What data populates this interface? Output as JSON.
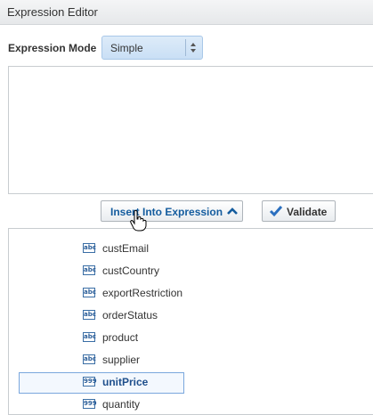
{
  "header": {
    "title": "Expression Editor"
  },
  "mode": {
    "label": "Expression Mode",
    "value": "Simple"
  },
  "expression": {
    "value": ""
  },
  "buttons": {
    "insert_label": "Insert Into Expression",
    "validate_label": "Validate"
  },
  "fields": [
    {
      "name": "custEmail",
      "type_icon": "abc"
    },
    {
      "name": "custCountry",
      "type_icon": "abc"
    },
    {
      "name": "exportRestriction",
      "type_icon": "abc"
    },
    {
      "name": "orderStatus",
      "type_icon": "abc"
    },
    {
      "name": "product",
      "type_icon": "abc"
    },
    {
      "name": "supplier",
      "type_icon": "abc"
    },
    {
      "name": "unitPrice",
      "type_icon": "999",
      "selected": true
    },
    {
      "name": "quantity",
      "type_icon": "999"
    }
  ]
}
